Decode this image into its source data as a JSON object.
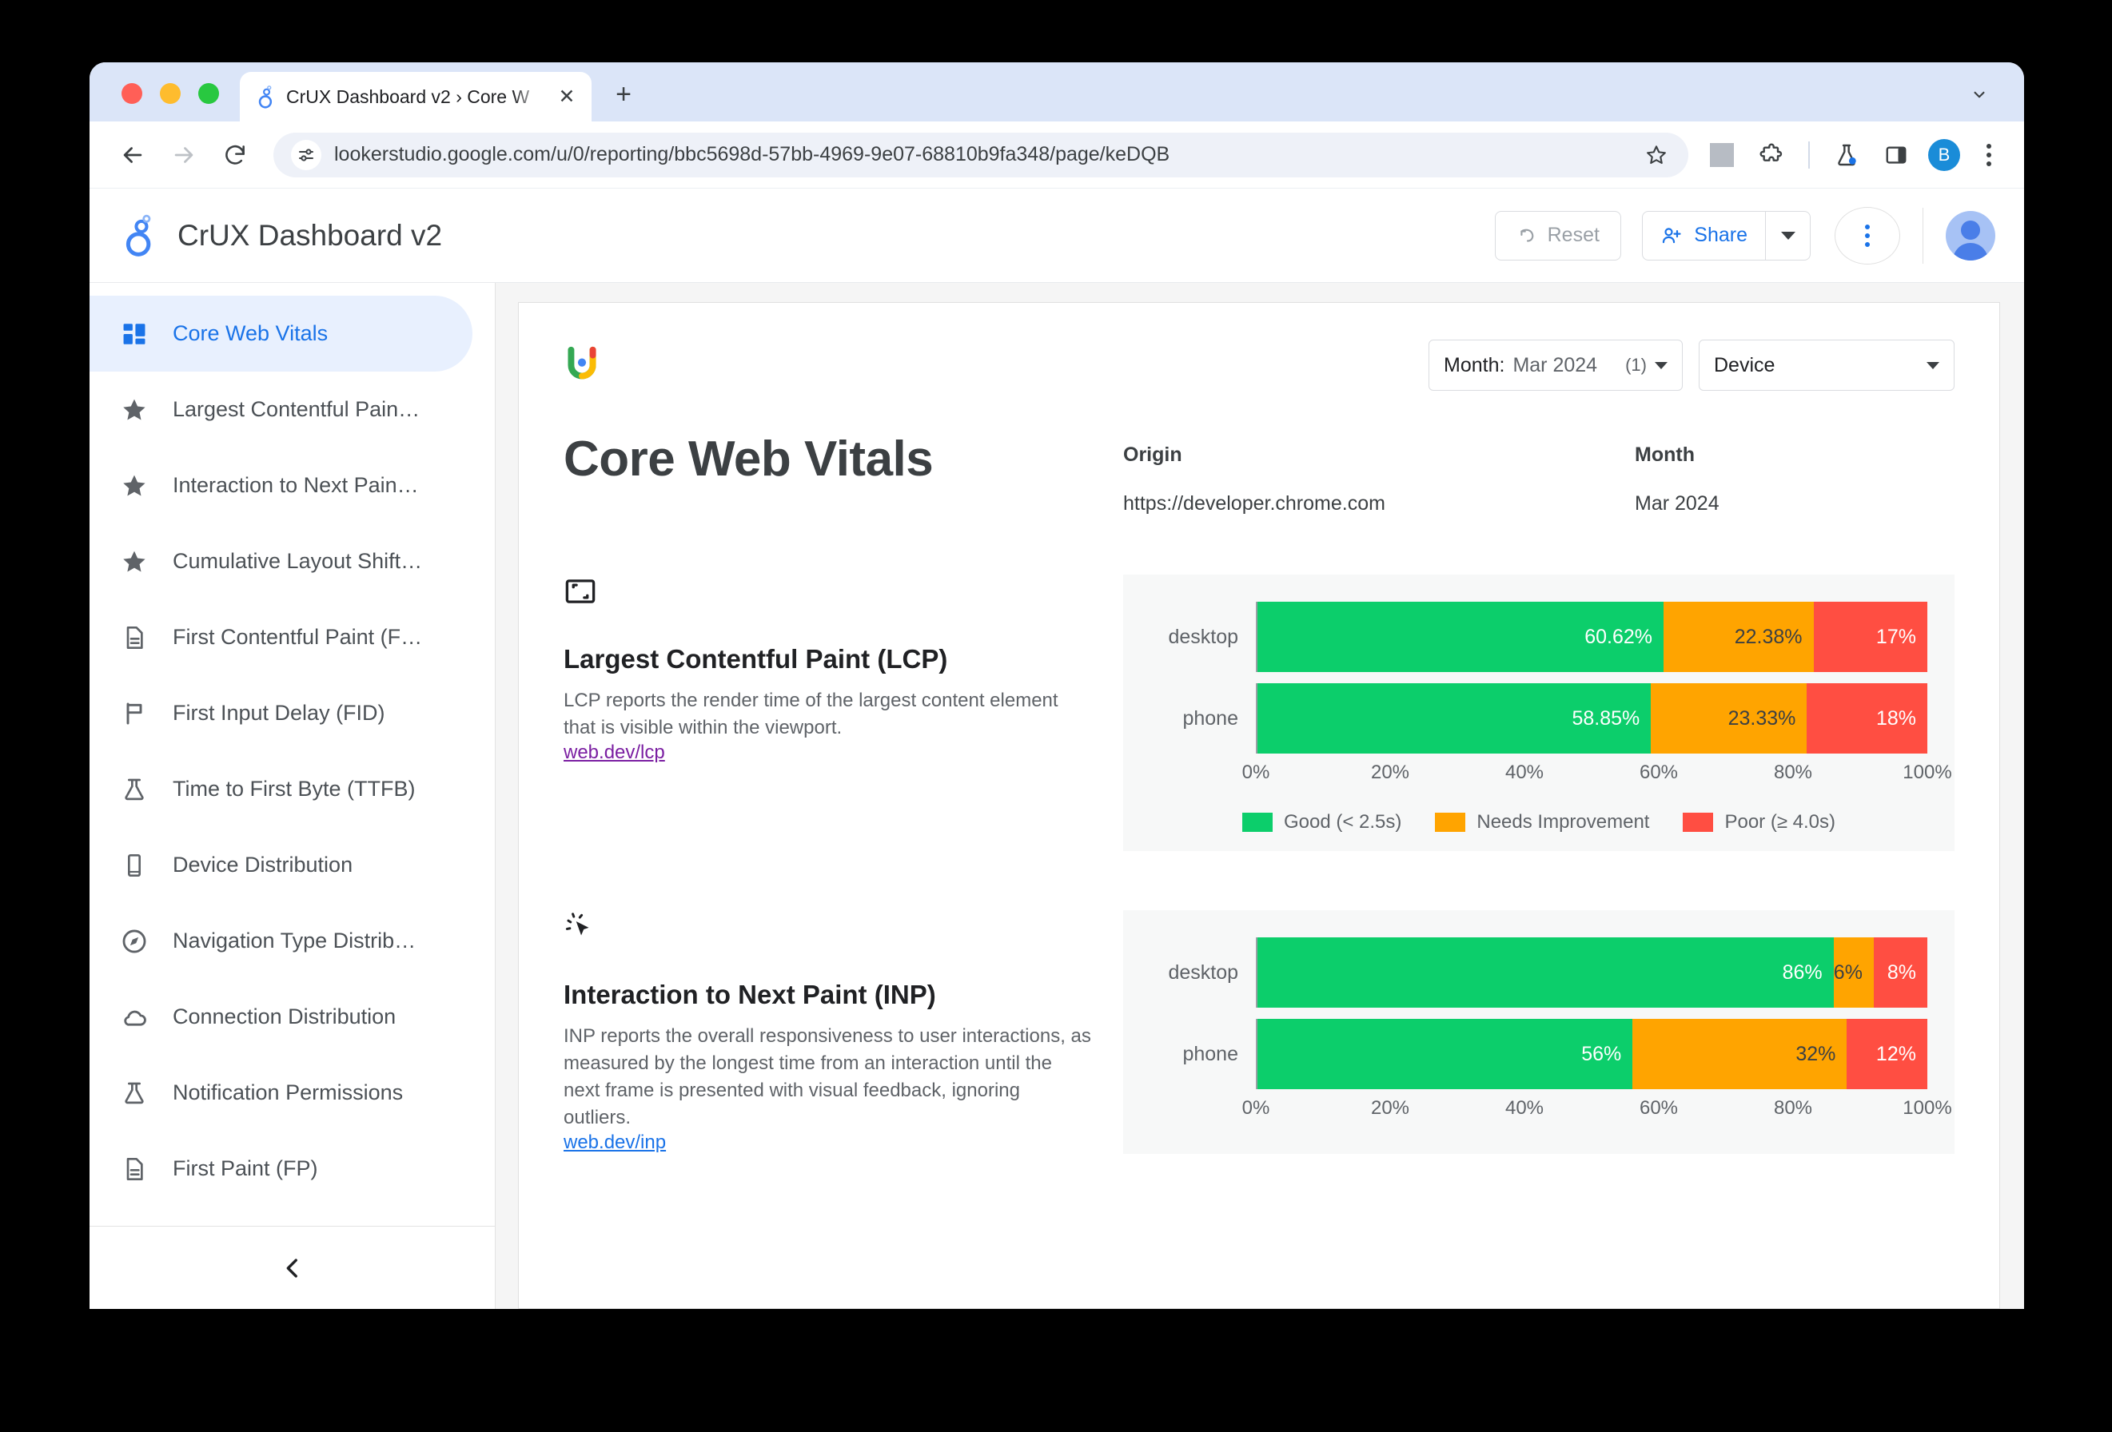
{
  "browser": {
    "tab": {
      "title": "CrUX Dashboard v2 › Core W",
      "favicon": "crux-favicon",
      "close_label": "✕"
    },
    "new_tab_label": "+",
    "url": "lookerstudio.google.com/u/0/reporting/bbc5698d-57bb-4969-9e07-68810b9fa348/page/keDQB",
    "profile_initial": "B"
  },
  "app": {
    "title": "CrUX Dashboard v2",
    "reset_label": "Reset",
    "share_label": "Share"
  },
  "sidebar": {
    "items": [
      {
        "label": "Core Web Vitals",
        "icon": "dashboard-icon",
        "active": true
      },
      {
        "label": "Largest Contentful Pain…",
        "icon": "star-icon",
        "active": false
      },
      {
        "label": "Interaction to Next Pain…",
        "icon": "star-icon",
        "active": false
      },
      {
        "label": "Cumulative Layout Shift…",
        "icon": "star-icon",
        "active": false
      },
      {
        "label": "First Contentful Paint (F…",
        "icon": "document-icon",
        "active": false
      },
      {
        "label": "First Input Delay (FID)",
        "icon": "flag-icon",
        "active": false
      },
      {
        "label": "Time to First Byte (TTFB)",
        "icon": "flask-icon",
        "active": false
      },
      {
        "label": "Device Distribution",
        "icon": "phone-icon",
        "active": false
      },
      {
        "label": "Navigation Type Distrib…",
        "icon": "compass-icon",
        "active": false
      },
      {
        "label": "Connection Distribution",
        "icon": "cloud-icon",
        "active": false
      },
      {
        "label": "Notification Permissions",
        "icon": "flask-icon",
        "active": false
      },
      {
        "label": "First Paint (FP)",
        "icon": "document-icon",
        "active": false
      }
    ]
  },
  "report": {
    "filters": {
      "month": {
        "label": "Month:",
        "value": "Mar 2024",
        "count": "(1)"
      },
      "device": {
        "label": "Device"
      }
    },
    "page_title": "Core Web Vitals",
    "origin": {
      "label": "Origin",
      "value": "https://developer.chrome.com"
    },
    "month": {
      "label": "Month",
      "value": "Mar 2024"
    },
    "metrics": [
      {
        "icon": "lcp-icon",
        "title": "Largest Contentful Paint (LCP)",
        "description": "LCP reports the render time of the largest content element that is visible within the viewport.",
        "link": "web.dev/lcp",
        "link_state": "visited"
      },
      {
        "icon": "inp-cursor-icon",
        "title": "Interaction to Next Paint (INP)",
        "description": "INP reports the overall responsiveness to user interactions, as measured by the longest time from an interaction until the next frame is presented with visual feedback, ignoring outliers.",
        "link": "web.dev/inp",
        "link_state": "fresh"
      }
    ]
  },
  "chart_data": [
    {
      "type": "bar",
      "orientation": "horizontal",
      "stacked": true,
      "title": "Largest Contentful Paint (LCP)",
      "categories": [
        "desktop",
        "phone"
      ],
      "series": [
        {
          "name": "Good (< 2.5s)",
          "color": "#0cce6b",
          "values": [
            60.62,
            58.85
          ],
          "labels": [
            "60.62%",
            "58.85%"
          ]
        },
        {
          "name": "Needs Improvement",
          "color": "#ffa400",
          "values": [
            22.38,
            23.33
          ],
          "labels": [
            "22.38%",
            "23.33%"
          ]
        },
        {
          "name": "Poor (≥ 4.0s)",
          "color": "#ff4e42",
          "values": [
            17,
            18
          ],
          "labels": [
            "17%",
            "18%"
          ]
        }
      ],
      "xlabel": "",
      "ylabel": "",
      "xlim": [
        0,
        100
      ],
      "xticks": [
        "0%",
        "20%",
        "40%",
        "60%",
        "80%",
        "100%"
      ],
      "grid": true,
      "legend_position": "bottom"
    },
    {
      "type": "bar",
      "orientation": "horizontal",
      "stacked": true,
      "title": "Interaction to Next Paint (INP)",
      "categories": [
        "desktop",
        "phone"
      ],
      "series": [
        {
          "name": "Good (< 2.5s)",
          "color": "#0cce6b",
          "values": [
            86,
            56
          ],
          "labels": [
            "86%",
            "56%"
          ]
        },
        {
          "name": "Needs Improvement",
          "color": "#ffa400",
          "values": [
            6,
            32
          ],
          "labels": [
            "6%",
            "32%"
          ]
        },
        {
          "name": "Poor (≥ 4.0s)",
          "color": "#ff4e42",
          "values": [
            8,
            12
          ],
          "labels": [
            "8%",
            "12%"
          ]
        }
      ],
      "xlabel": "",
      "ylabel": "",
      "xlim": [
        0,
        100
      ],
      "xticks": [
        "0%",
        "20%",
        "40%",
        "60%",
        "80%",
        "100%"
      ],
      "grid": true,
      "legend_position": "none"
    }
  ],
  "colors": {
    "good": "#0cce6b",
    "needs_improvement": "#ffa400",
    "poor": "#ff4e42",
    "accent": "#1a73e8"
  }
}
